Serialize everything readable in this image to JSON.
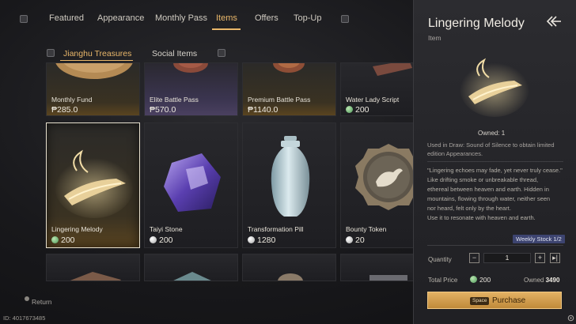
{
  "tabs": [
    {
      "label": "Featured"
    },
    {
      "label": "Appearance"
    },
    {
      "label": "Monthly Pass"
    },
    {
      "label": "Items",
      "active": true
    },
    {
      "label": "Offers"
    },
    {
      "label": "Top-Up"
    }
  ],
  "subtabs": [
    {
      "label": "Jianghu Treasures",
      "active": true
    },
    {
      "label": "Social Items"
    }
  ],
  "items": [
    {
      "name": "Monthly Fund",
      "price": "₱285.0"
    },
    {
      "name": "Elite Battle Pass",
      "price": "₱570.0"
    },
    {
      "name": "Premium Battle Pass",
      "price": "₱1140.0"
    },
    {
      "name": "Water Lady Script",
      "price": "200",
      "currency": "jade"
    },
    {
      "name": "Lingering Melody",
      "price": "200",
      "currency": "jade",
      "selected": true
    },
    {
      "name": "Taiyi Stone",
      "price": "200",
      "currency": "pearl"
    },
    {
      "name": "Transformation Pill",
      "price": "1280",
      "currency": "pearl"
    },
    {
      "name": "Bounty Token",
      "price": "20",
      "currency": "pearl"
    }
  ],
  "footer": {
    "return_label": "Return",
    "player_id": "ID: 4017673485"
  },
  "detail": {
    "title": "Lingering Melody",
    "subtitle": "Item",
    "owned_count": "Owned: 1",
    "usage": "Used in Draw: Sound of Silence to obtain limited edition Appearances.",
    "description_lines": [
      "\"Lingering echoes may fade, yet never truly cease.\"",
      "Like drifting smoke or unbreakable thread,",
      "ethereal between heaven and earth. Hidden in",
      "mountains, flowing through water, neither seen",
      "nor heard, felt only by the heart.",
      "Use it to resonate with heaven and earth."
    ],
    "weekly_stock": "Weekly Stock 1/2",
    "quantity_label": "Quantity",
    "quantity_value": "1",
    "total_price_label": "Total Price",
    "total_price_value": "200",
    "owned_label": "Owned",
    "owned_value": "3490",
    "purchase_key": "Space",
    "purchase_label": "Purchase"
  },
  "colors": {
    "accent": "#e9b76a",
    "jade_currency": "#4f9a5a",
    "weekly_badge": "#3d4470"
  },
  "icons": [
    "back-arrow-icon",
    "settings-gear-icon",
    "return-icon"
  ]
}
